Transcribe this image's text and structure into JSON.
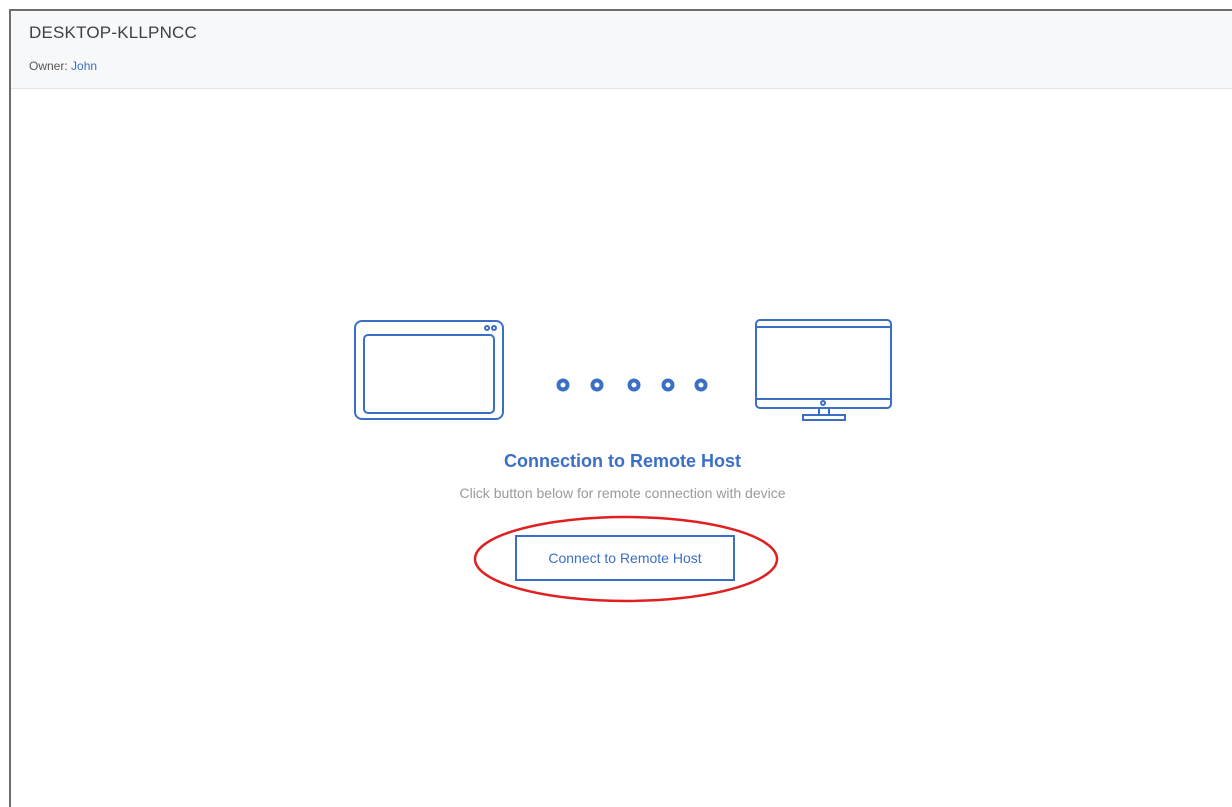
{
  "header": {
    "device_name": "DESKTOP-KLLPNCC",
    "owner_label": "Owner:",
    "owner_name": "John"
  },
  "main": {
    "title": "Connection to Remote Host",
    "subtitle": "Click button below for remote connection with device",
    "connect_button_label": "Connect to Remote Host"
  },
  "illustration": {
    "left_device_icon": "tablet-icon",
    "right_device_icon": "monitor-icon",
    "connector_icon": "connection-dots-icon",
    "dot_count": 5
  },
  "annotation": {
    "highlight_icon": "red-ellipse-highlight"
  },
  "colors": {
    "accent": "#3b6fc6",
    "highlight": "#e02020",
    "subtitle": "#9a9a9a",
    "header_bg": "#f7f8fa"
  }
}
